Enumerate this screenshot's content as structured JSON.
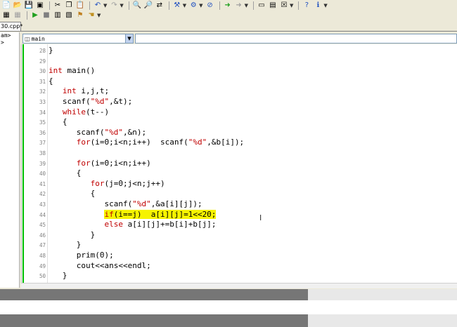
{
  "file_tab": {
    "label": "30.cpp*"
  },
  "left_panel": {
    "lines": [
      "am>",
      ">"
    ]
  },
  "combo": {
    "selected": "main"
  },
  "icons": {
    "toolbar1": [
      "new-icon",
      "open-icon",
      "save-icon",
      "save-all-icon",
      "cut-icon",
      "copy-icon",
      "paste-icon",
      "undo-icon",
      "redo-icon",
      "find-icon",
      "find-in-files-icon",
      "replace-icon",
      "compile-icon",
      "build-icon",
      "stop-build-icon",
      "execute-icon",
      "help-icon"
    ],
    "toolbar2": [
      "class-icon",
      "members-icon",
      "go-icon",
      "debug-icon",
      "breakpoint-icon",
      "watch-icon",
      "hand-icon"
    ]
  },
  "editor": {
    "lines": [
      {
        "n": "28",
        "text": "}"
      },
      {
        "n": "29",
        "text": ""
      },
      {
        "n": "30",
        "text": "int main()"
      },
      {
        "n": "31",
        "text": "{"
      },
      {
        "n": "32",
        "text": "   int i,j,t;"
      },
      {
        "n": "33",
        "text": "   scanf(\"%d\",&t);"
      },
      {
        "n": "34",
        "text": "   while(t--)"
      },
      {
        "n": "35",
        "text": "   {"
      },
      {
        "n": "36",
        "text": "      scanf(\"%d\",&n);"
      },
      {
        "n": "37",
        "text": "      for(i=0;i<n;i++)  scanf(\"%d\",&b[i]);"
      },
      {
        "n": "38",
        "text": ""
      },
      {
        "n": "39",
        "text": "      for(i=0;i<n;i++)"
      },
      {
        "n": "40",
        "text": "      {"
      },
      {
        "n": "41",
        "text": "         for(j=0;j<n;j++)"
      },
      {
        "n": "42",
        "text": "         {"
      },
      {
        "n": "43",
        "text": "            scanf(\"%d\",&a[i][j]);"
      },
      {
        "n": "44",
        "text": "            if(i==j)  a[i][j]=1<<20;"
      },
      {
        "n": "45",
        "text": "            else a[i][j]+=b[i]+b[j];"
      },
      {
        "n": "46",
        "text": "         }"
      },
      {
        "n": "47",
        "text": "      }"
      },
      {
        "n": "48",
        "text": "      prim(0);"
      },
      {
        "n": "49",
        "text": "      cout<<ans<<endl;"
      },
      {
        "n": "50",
        "text": "   }"
      }
    ],
    "highlight_line": "44",
    "highlight_color": "#f6f300",
    "keyword_color": "#c00000"
  }
}
